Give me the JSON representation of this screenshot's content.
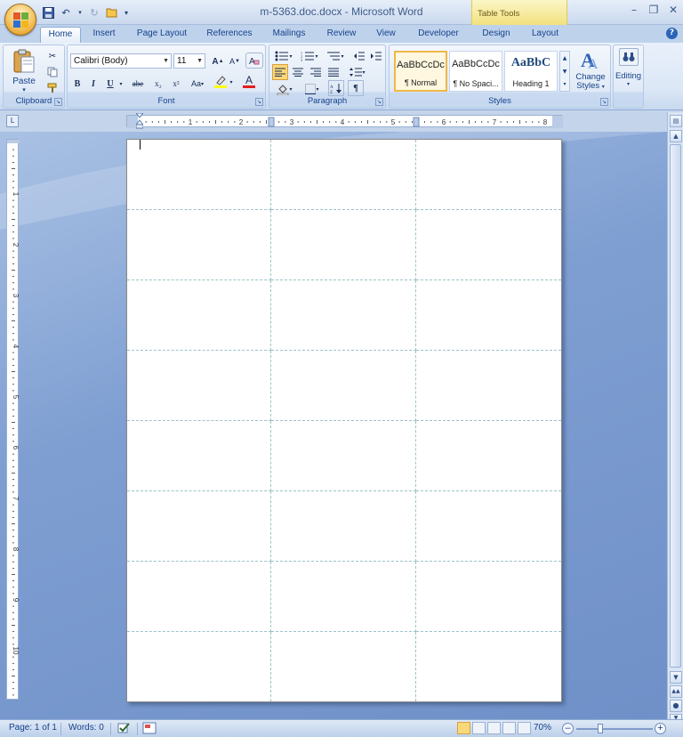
{
  "window": {
    "title": "m-5363.doc.docx - Microsoft Word",
    "contextual_tab_group": "Table Tools"
  },
  "tabs": [
    {
      "label": "Home",
      "active": true
    },
    {
      "label": "Insert"
    },
    {
      "label": "Page Layout"
    },
    {
      "label": "References"
    },
    {
      "label": "Mailings"
    },
    {
      "label": "Review"
    },
    {
      "label": "View"
    },
    {
      "label": "Developer"
    },
    {
      "label": "Design"
    },
    {
      "label": "Layout"
    }
  ],
  "ribbon": {
    "clipboard": {
      "label": "Clipboard",
      "paste_label": "Paste"
    },
    "font": {
      "label": "Font",
      "font_name": "Calibri (Body)",
      "font_size": "11",
      "bold": "B",
      "italic": "I",
      "underline": "U",
      "strike": "abe",
      "subscript": "x₂",
      "superscript": "x²",
      "change_case": "Aa",
      "grow": "A",
      "shrink": "A",
      "font_color": "A",
      "highlight_color": "#ffff00",
      "text_color": "#e02020"
    },
    "paragraph": {
      "label": "Paragraph",
      "pilcrow": "¶"
    },
    "styles": {
      "label": "Styles",
      "items": [
        {
          "sample": "AaBbCcDc",
          "name": "¶ Normal",
          "selected": true
        },
        {
          "sample": "AaBbCcDc",
          "name": "¶ No Spaci..."
        },
        {
          "sample": "AaBbC",
          "name": "Heading 1"
        }
      ],
      "change_styles_line1": "Change",
      "change_styles_line2": "Styles"
    },
    "editing": {
      "label": "Editing"
    }
  },
  "ruler": {
    "h_numbers": [
      "1",
      "2",
      "3",
      "4",
      "5",
      "6",
      "7",
      "8"
    ],
    "v_numbers": [
      "1",
      "2",
      "3",
      "4",
      "5",
      "6",
      "7",
      "8",
      "9",
      "10"
    ]
  },
  "document": {
    "table_rows": 8,
    "table_cols": 3
  },
  "statusbar": {
    "page": "Page: 1 of 1",
    "words": "Words: 0",
    "zoom": "70%"
  }
}
